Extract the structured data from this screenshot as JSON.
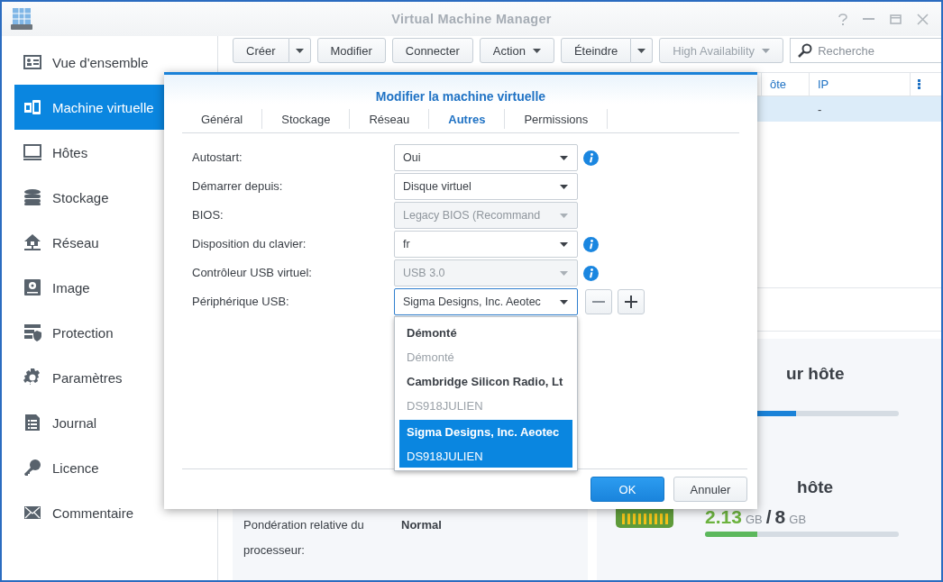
{
  "window": {
    "title": "Virtual Machine Manager"
  },
  "sidebar": {
    "items": [
      {
        "label": "Vue d'ensemble",
        "selected": false
      },
      {
        "label": "Machine virtuelle",
        "selected": true
      },
      {
        "label": "Hôtes",
        "selected": false
      },
      {
        "label": "Stockage",
        "selected": false
      },
      {
        "label": "Réseau",
        "selected": false
      },
      {
        "label": "Image",
        "selected": false
      },
      {
        "label": "Protection",
        "selected": false
      },
      {
        "label": "Paramètres",
        "selected": false
      },
      {
        "label": "Journal",
        "selected": false
      },
      {
        "label": "Licence",
        "selected": false
      },
      {
        "label": "Commentaire",
        "selected": false
      }
    ]
  },
  "toolbar": {
    "buttons": [
      {
        "label": "Créer",
        "kind": "split",
        "disabled": false
      },
      {
        "label": "Modifier",
        "kind": "plain",
        "disabled": false
      },
      {
        "label": "Connecter",
        "kind": "plain",
        "disabled": false
      },
      {
        "label": "Action",
        "kind": "menu",
        "disabled": false
      },
      {
        "label": "Éteindre",
        "kind": "split",
        "disabled": false
      },
      {
        "label": "High Availability",
        "kind": "menu",
        "disabled": true
      }
    ],
    "search": {
      "placeholder": "Recherche"
    }
  },
  "table": {
    "columns": [
      {
        "label": "ôte"
      },
      {
        "label": "IP"
      }
    ],
    "rows": [
      {
        "ip": "-",
        "selected": true
      }
    ]
  },
  "vm_details": {
    "rows": [
      {
        "label": "Pondération relative du processeur:",
        "value": "Normal"
      }
    ]
  },
  "host_cards": [
    {
      "kind": "cpu",
      "title": "ur hôte",
      "level": 0.47
    },
    {
      "kind": "memory",
      "title": "hôte",
      "used": "2.13",
      "used_unit": "GB",
      "separator": "/",
      "total": "8",
      "total_unit": "GB",
      "level": 0.27
    }
  ],
  "dialog": {
    "title": "Modifier la machine virtuelle",
    "tabs": [
      {
        "label": "Général",
        "selected": false
      },
      {
        "label": "Stockage",
        "selected": false
      },
      {
        "label": "Réseau",
        "selected": false
      },
      {
        "label": "Autres",
        "selected": true
      },
      {
        "label": "Permissions",
        "selected": false
      }
    ],
    "fields": [
      {
        "label": "Autostart:",
        "value": "Oui",
        "disabled": false,
        "focused": false,
        "info": true,
        "add_remove": false
      },
      {
        "label": "Démarrer depuis:",
        "value": "Disque virtuel",
        "disabled": false,
        "focused": false,
        "info": false,
        "add_remove": false
      },
      {
        "label": "BIOS:",
        "value": "Legacy BIOS (Recommand",
        "disabled": true,
        "focused": false,
        "info": false,
        "add_remove": false
      },
      {
        "label": "Disposition du clavier:",
        "value": "fr",
        "disabled": false,
        "focused": false,
        "info": true,
        "add_remove": false
      },
      {
        "label": "Contrôleur USB virtuel:",
        "value": "USB 3.0",
        "disabled": true,
        "focused": false,
        "info": true,
        "add_remove": false
      },
      {
        "label": "Périphérique USB:",
        "value": "Sigma Designs, Inc. Aeotec",
        "disabled": false,
        "focused": true,
        "info": false,
        "add_remove": true
      }
    ],
    "dropdown": {
      "options": [
        {
          "label": "Démonté",
          "detail": "Démonté",
          "selected": false
        },
        {
          "label": "Cambridge Silicon Radio, Lt",
          "detail": "DS918JULIEN",
          "selected": false
        },
        {
          "label": "Sigma Designs, Inc. Aeotec",
          "detail": "DS918JULIEN",
          "selected": true
        }
      ]
    },
    "buttons": [
      {
        "label": "OK",
        "kind": "primary"
      },
      {
        "label": "Annuler",
        "kind": "secondary"
      }
    ]
  }
}
